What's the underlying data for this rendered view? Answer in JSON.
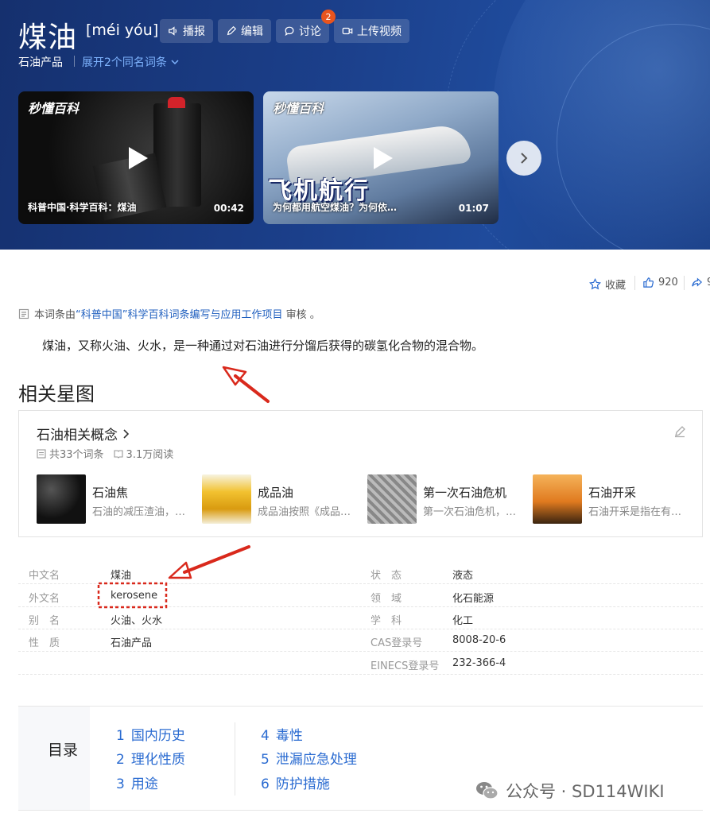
{
  "header": {
    "title": "煤油",
    "pinyin": "[méi yóu]",
    "buttons": {
      "play": "播报",
      "edit": "编辑",
      "discuss": "讨论",
      "upload": "上传视频"
    },
    "discuss_badge": "2",
    "category": "石油产品",
    "expand_link": "展开2个同名词条"
  },
  "videos": [
    {
      "logo": "秒懂百科",
      "caption": "科普中国·科学百科：煤油",
      "duration": "00:42"
    },
    {
      "logo": "秒懂百科",
      "banner": "飞机航行",
      "caption": "为何都用航空煤油？为何依…",
      "duration": "01:07"
    }
  ],
  "toolbar": {
    "favorite": "收藏",
    "likes": "920",
    "share": "9"
  },
  "notice": {
    "prefix": "本词条由",
    "link": "“科普中国”科学百科词条编写与应用工作项目",
    "suffix": " 审核 。"
  },
  "lead": "煤油，又称火油、火水，是一种通过对石油进行分馏后获得的碳氢化合物的混合物。",
  "section_title": "相关星图",
  "starmap": {
    "title": "石油相关概念",
    "entries": "共33个词条",
    "reads": "3.1万阅读",
    "concepts": [
      {
        "name": "石油焦",
        "desc": "石油的减压渣油，…"
      },
      {
        "name": "成品油",
        "desc": "成品油按照《成品…"
      },
      {
        "name": "第一次石油危机",
        "desc": "第一次石油危机，…"
      },
      {
        "name": "石油开采",
        "desc": "石油开采是指在有…"
      }
    ]
  },
  "info_left": [
    {
      "label": "中文名",
      "value": "煤油"
    },
    {
      "label": "外文名",
      "value": "kerosene"
    },
    {
      "label": "别　名",
      "value": "火油、火水"
    },
    {
      "label": "性　质",
      "value": "石油产品"
    }
  ],
  "info_right": [
    {
      "label": "状　态",
      "value": "液态"
    },
    {
      "label": "领　域",
      "value": "化石能源"
    },
    {
      "label": "学　科",
      "value": "化工"
    },
    {
      "label": "CAS登录号",
      "value": "8008-20-6"
    },
    {
      "label": "EINECS登录号",
      "value": "232-366-4"
    }
  ],
  "toc": {
    "label": "目录",
    "items": [
      {
        "num": "1",
        "text": "国内历史"
      },
      {
        "num": "2",
        "text": "理化性质"
      },
      {
        "num": "3",
        "text": "用途"
      },
      {
        "num": "4",
        "text": "毒性"
      },
      {
        "num": "5",
        "text": "泄漏应急处理"
      },
      {
        "num": "6",
        "text": "防护措施"
      }
    ]
  },
  "watermark": "公众号 · SD114WIKI",
  "colors": {
    "link": "#1f5fbf",
    "toc": "#2a6bd1",
    "annotation": "#d9291c",
    "header_bg": "#1b3f8a"
  }
}
